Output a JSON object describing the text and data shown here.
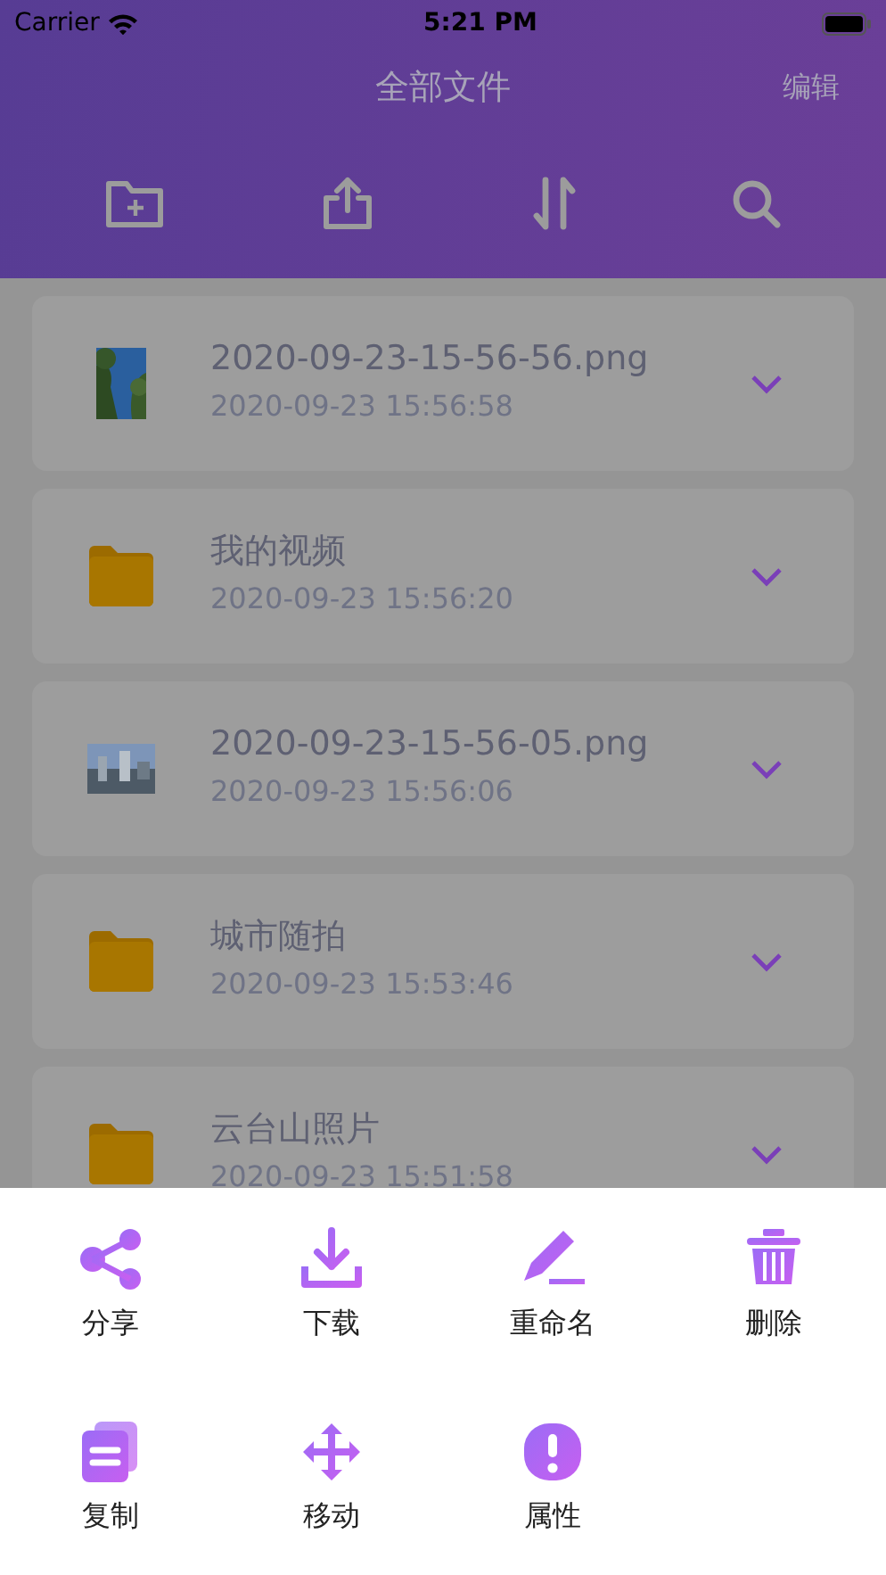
{
  "status_bar": {
    "carrier": "Carrier",
    "time": "5:21 PM"
  },
  "header": {
    "title": "全部文件",
    "edit": "编辑"
  },
  "files": [
    {
      "name": "2020-09-23-15-56-56.png",
      "date": "2020-09-23 15:56:58"
    },
    {
      "kind": "folder",
      "name": "我的视频",
      "date": "2020-09-23 15:56:20"
    },
    {
      "name": "2020-09-23-15-56-05.png",
      "date": "2020-09-23 15:56:06"
    },
    {
      "kind": "folder",
      "name": "城市随拍",
      "date": "2020-09-23 15:53:46"
    },
    {
      "kind": "folder",
      "name": "云台山照片",
      "date": "2020-09-23 15:51:58"
    }
  ],
  "actions": [
    {
      "label": "分享"
    },
    {
      "label": "下载"
    },
    {
      "label": "重命名"
    },
    {
      "label": "删除"
    },
    {
      "label": "复制"
    },
    {
      "label": "移动"
    },
    {
      "label": "属性"
    }
  ]
}
